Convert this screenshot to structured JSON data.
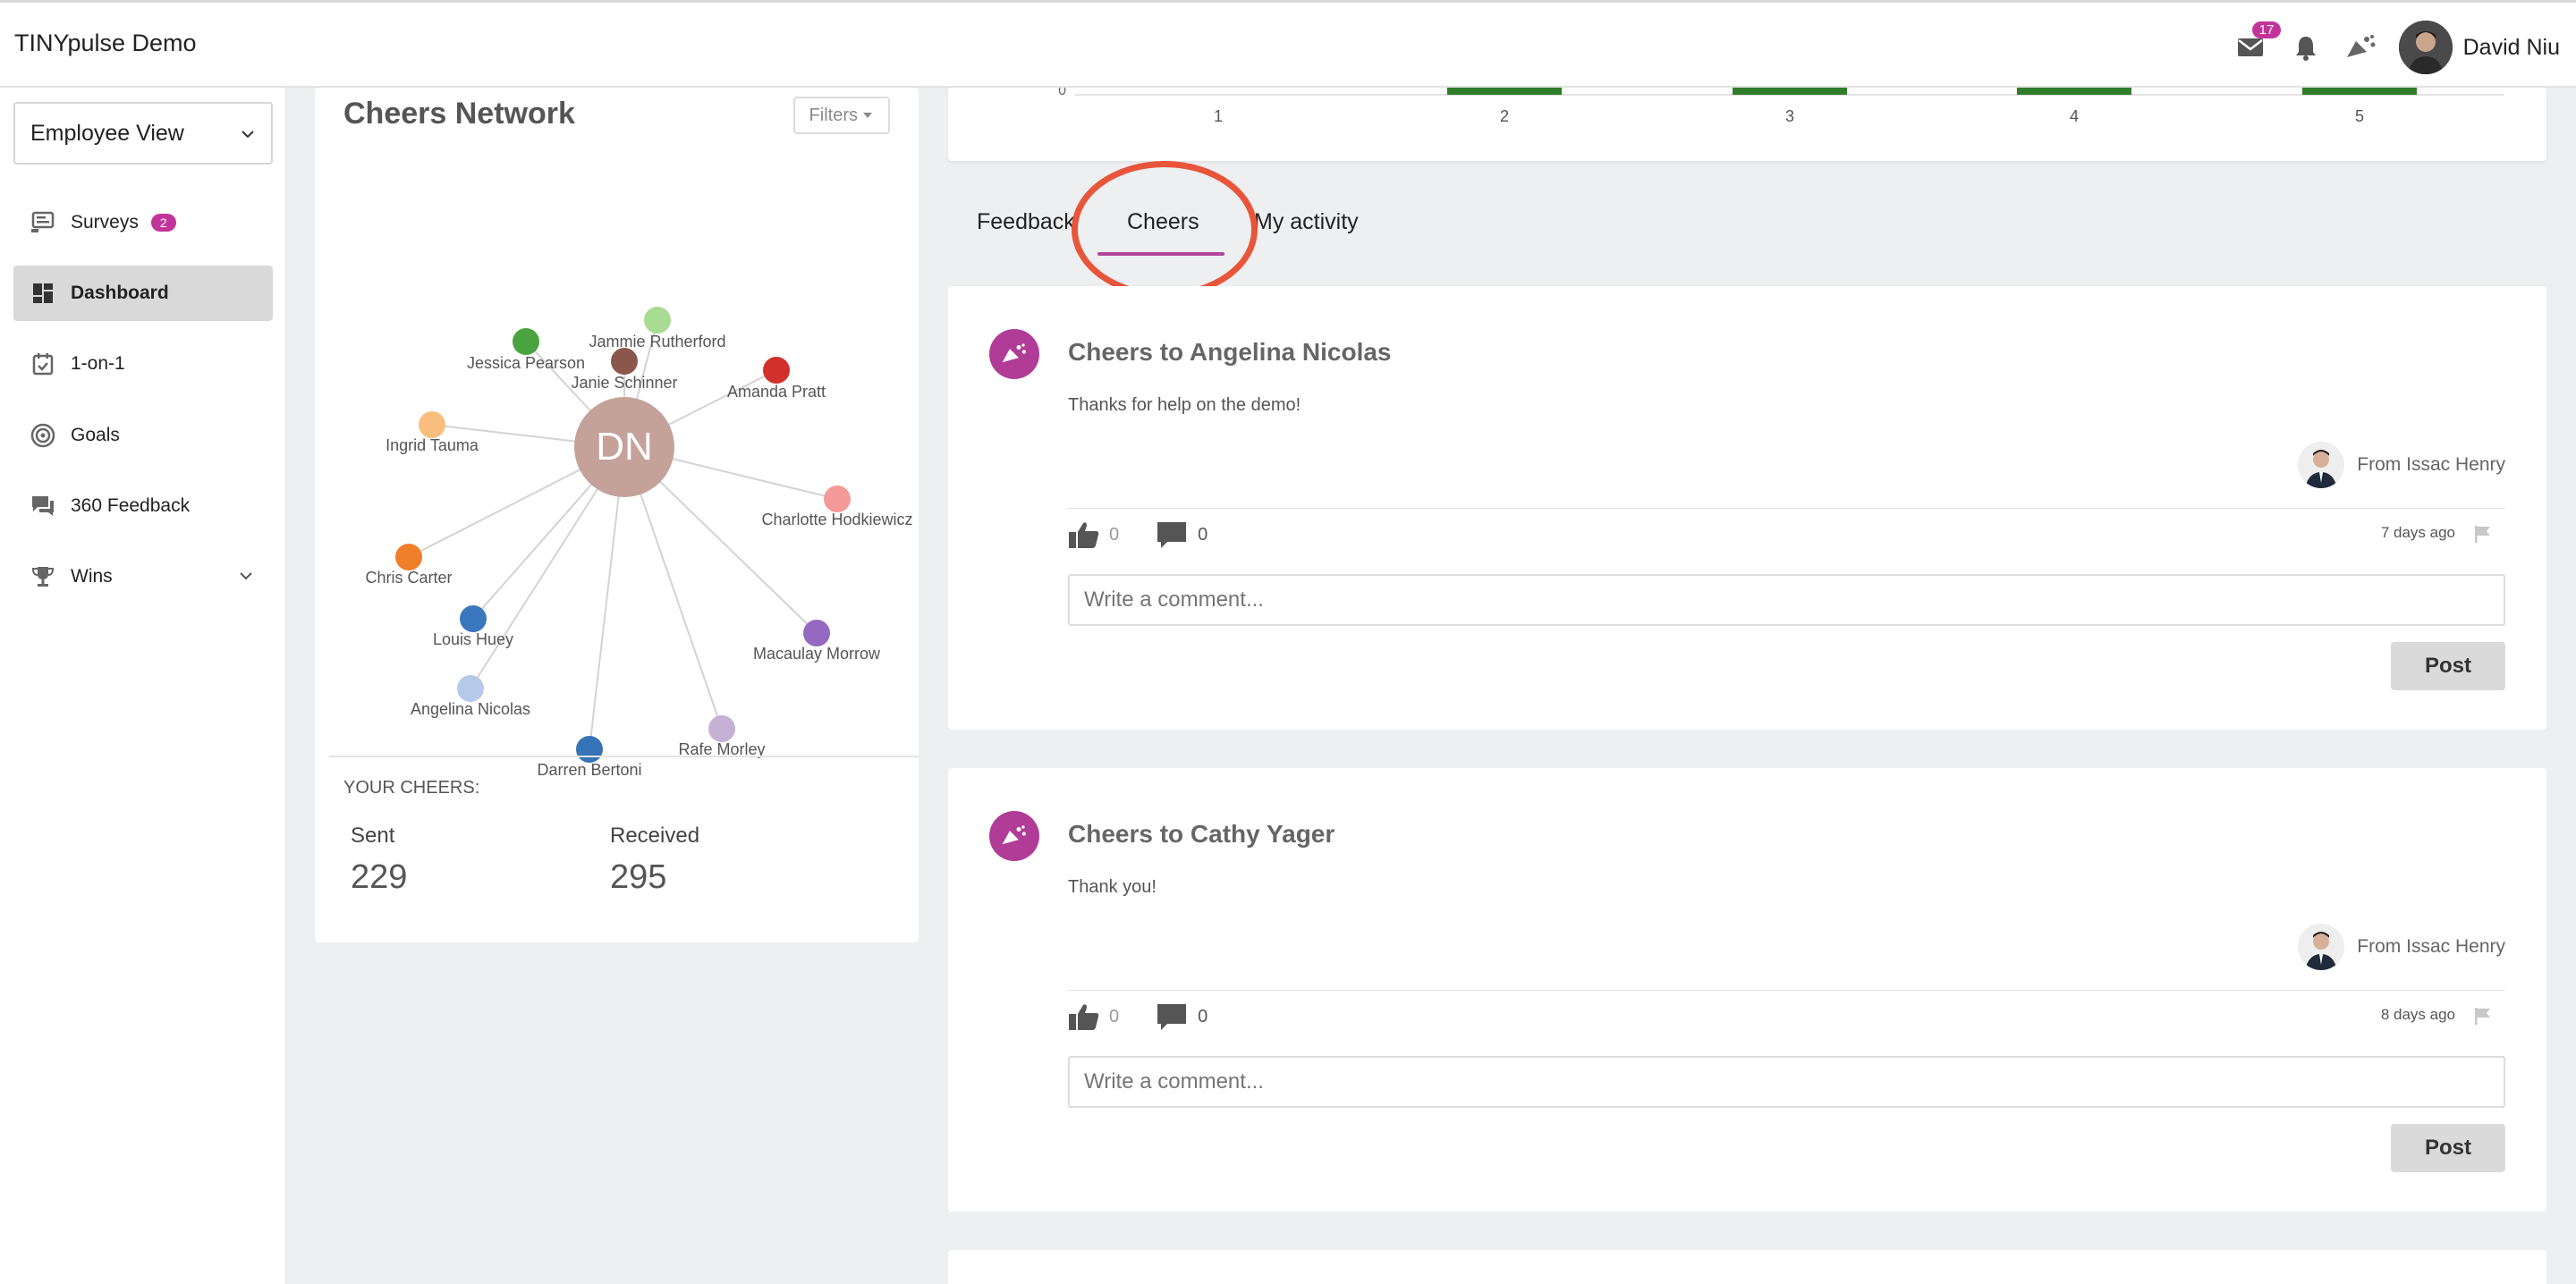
{
  "app": {
    "title": "TINYpulse Demo"
  },
  "header": {
    "mail_count": "17",
    "user_name": "David Niu",
    "icons": [
      "mail-icon",
      "bell-icon",
      "cheers-icon"
    ]
  },
  "sidebar": {
    "view_select": "Employee View",
    "items": [
      {
        "label": "Surveys",
        "badge": "2",
        "icon": "survey-icon"
      },
      {
        "label": "Dashboard",
        "icon": "dashboard-icon",
        "active": true
      },
      {
        "label": "1-on-1",
        "icon": "calendar-icon"
      },
      {
        "label": "Goals",
        "icon": "target-icon"
      },
      {
        "label": "360 Feedback",
        "icon": "chat-icon"
      },
      {
        "label": "Wins",
        "icon": "trophy-icon"
      }
    ]
  },
  "cheers_network": {
    "title": "Cheers Network",
    "filters_label": "Filters",
    "center_initials": "DN",
    "center_color": "#c4a29a",
    "nodes": [
      {
        "name": "Jessica Pearson",
        "color": "#4aa43e"
      },
      {
        "name": "Jammie Rutherford",
        "color": "#a9dc93"
      },
      {
        "name": "Janie Schinner",
        "color": "#8b564b"
      },
      {
        "name": "Amanda Pratt",
        "color": "#d1302b"
      },
      {
        "name": "Ingrid Tauma",
        "color": "#f9be7d"
      },
      {
        "name": "Charlotte Hodkiewicz",
        "color": "#f39a98"
      },
      {
        "name": "Chris Carter",
        "color": "#f07f2a"
      },
      {
        "name": "Louis Huey",
        "color": "#3a77bd"
      },
      {
        "name": "Macaulay Morrow",
        "color": "#9469c1"
      },
      {
        "name": "Angelina Nicolas",
        "color": "#b6c9e8"
      },
      {
        "name": "Rafe Morley",
        "color": "#c5b1d6"
      },
      {
        "name": "Darren Bertoni",
        "color": "#3673b7"
      }
    ],
    "your_cheers_label": "YOUR CHEERS:",
    "sent_label": "Sent",
    "sent_value": "229",
    "received_label": "Received",
    "received_value": "295"
  },
  "chart_strip": {
    "tick_zero": "0",
    "ticks": [
      "1",
      "2",
      "3",
      "4",
      "5"
    ],
    "bar_color": "#2f7d28"
  },
  "tabs": [
    {
      "label": "Feedback"
    },
    {
      "label": "Cheers",
      "active": true
    },
    {
      "label": "My activity"
    }
  ],
  "feed": [
    {
      "title": "Cheers to Angelina Nicolas",
      "message": "Thanks for help on the demo!",
      "from": "From Issac Henry",
      "likes": "0",
      "comments": "0",
      "time": "7 days ago",
      "comment_placeholder": "Write a comment...",
      "post_label": "Post"
    },
    {
      "title": "Cheers to Cathy Yager",
      "message": "Thank you!",
      "from": "From Issac Henry",
      "likes": "0",
      "comments": "0",
      "time": "8 days ago",
      "comment_placeholder": "Write a comment...",
      "post_label": "Post"
    }
  ],
  "colors": {
    "accent": "#c2349a",
    "tab_underline": "#b0479a",
    "highlight": "#e8553a"
  }
}
